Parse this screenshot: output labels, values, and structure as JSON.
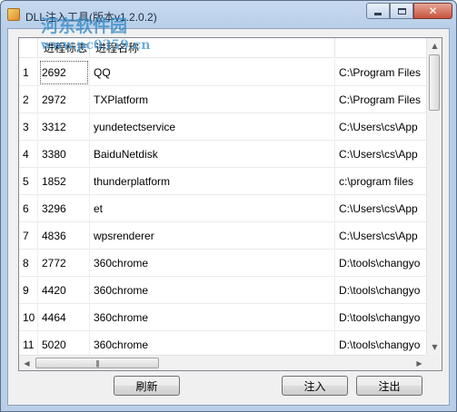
{
  "window": {
    "title": "DLL注入工具(版本v1.2.0.2)",
    "watermark": "河东软件园",
    "watermark_url": "www.pc0359.cn"
  },
  "table": {
    "columns": [
      "",
      "进程标志",
      "进程名称",
      ""
    ],
    "rows": [
      [
        "1",
        "2692",
        "QQ",
        "C:\\Program Files"
      ],
      [
        "2",
        "2972",
        "TXPlatform",
        "C:\\Program Files"
      ],
      [
        "3",
        "3312",
        "yundetectservice",
        "C:\\Users\\cs\\App"
      ],
      [
        "4",
        "3380",
        "BaiduNetdisk",
        "C:\\Users\\cs\\App"
      ],
      [
        "5",
        "1852",
        "thunderplatform",
        "c:\\program files"
      ],
      [
        "6",
        "3296",
        "et",
        "C:\\Users\\cs\\App"
      ],
      [
        "7",
        "4836",
        "wpsrenderer",
        "C:\\Users\\cs\\App"
      ],
      [
        "8",
        "2772",
        "360chrome",
        "D:\\tools\\changyo"
      ],
      [
        "9",
        "4420",
        "360chrome",
        "D:\\tools\\changyo"
      ],
      [
        "10",
        "4464",
        "360chrome",
        "D:\\tools\\changyo"
      ],
      [
        "11",
        "5020",
        "360chrome",
        "D:\\tools\\changyo"
      ]
    ]
  },
  "buttons": {
    "refresh": "刷新",
    "inject": "注入",
    "eject": "注出"
  }
}
